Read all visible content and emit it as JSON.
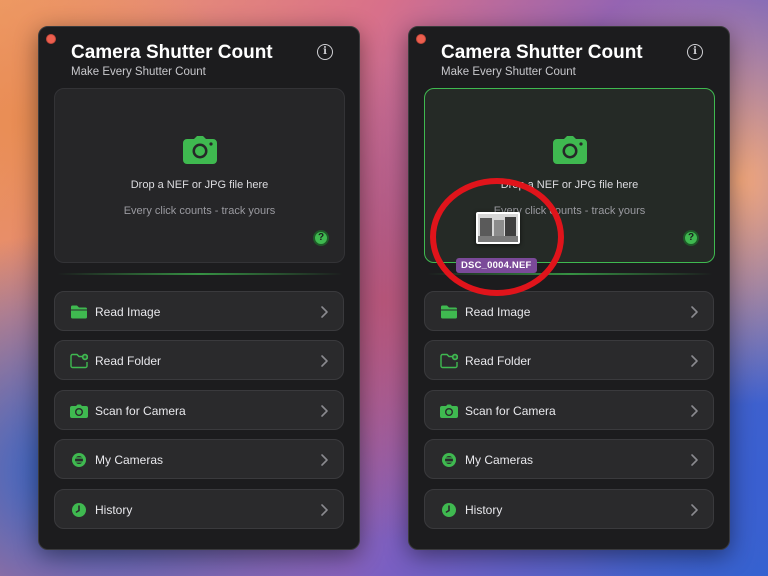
{
  "app": {
    "title": "Camera Shutter Count",
    "subtitle": "Make Every Shutter Count"
  },
  "drop_zone": {
    "prompt": "Drop a NEF or JPG file here",
    "hint": "Every click counts - track yours",
    "icon": "camera-icon",
    "accent_color": "#3fb950"
  },
  "menu": [
    {
      "label": "Read Image",
      "icon": "folder-icon"
    },
    {
      "label": "Read Folder",
      "icon": "folder-add-icon"
    },
    {
      "label": "Scan for Camera",
      "icon": "camera-icon"
    },
    {
      "label": "My Cameras",
      "icon": "camera-lens-icon"
    },
    {
      "label": "History",
      "icon": "clock-icon"
    }
  ],
  "drag": {
    "file_name": "DSC_0004.NEF",
    "highlight_color": "#e0141b"
  }
}
